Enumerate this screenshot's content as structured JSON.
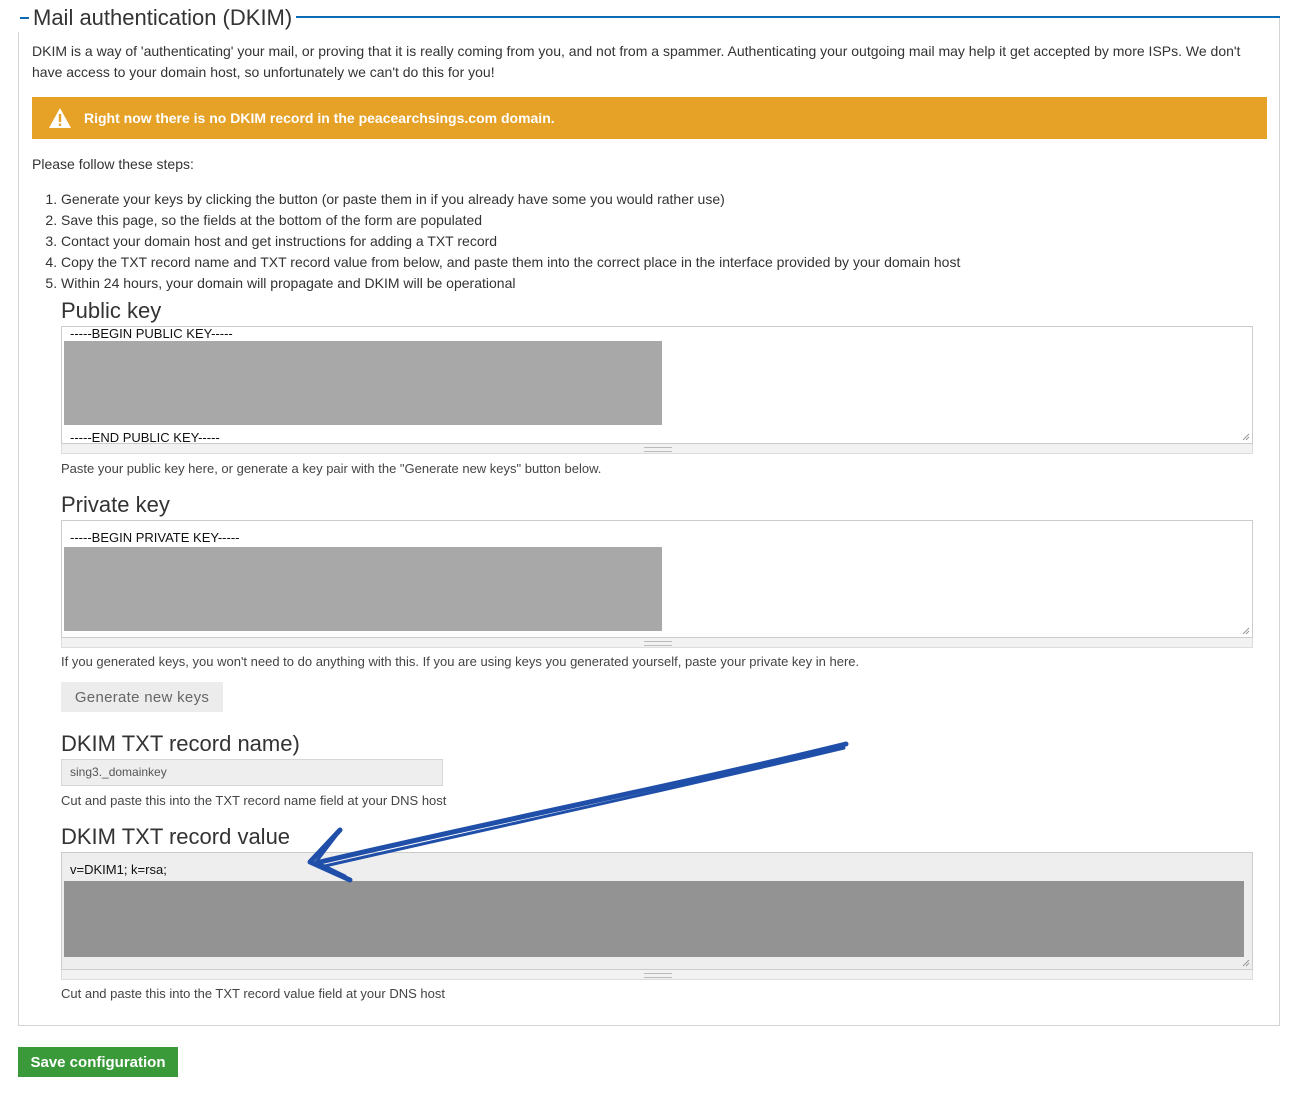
{
  "fieldset": {
    "legend": "Mail authentication (DKIM)",
    "accent_color": "#0c6bb5"
  },
  "intro": "DKIM is a way of 'authenticating' your mail, or proving that it is really coming from you, and not from a spammer. Authenticating your outgoing mail may help it get accepted by more ISPs. We don't have access to your domain host, so unfortunately we can't do this for you!",
  "warning": {
    "icon": "warning-triangle-icon",
    "text": "Right now there is no DKIM record in the peacearchsings.com domain.",
    "color": "#e6a127"
  },
  "steps_intro": "Please follow these steps:",
  "steps": [
    "Generate your keys by clicking the button (or paste them in if you already have some you would rather use)",
    "Save this page, so the fields at the bottom of the form are populated",
    "Contact your domain host and get instructions for adding a TXT record",
    "Copy the TXT record name and TXT record value from below, and paste them into the correct place in the interface provided by your domain host",
    "Within 24 hours, your domain will propagate and DKIM will be operational"
  ],
  "public_key": {
    "label": "Public key",
    "begin": "-----BEGIN PUBLIC KEY-----",
    "end": "-----END PUBLIC KEY-----",
    "description": "Paste your public key here, or generate a key pair with the \"Generate new keys\" button below."
  },
  "private_key": {
    "label": "Private key",
    "begin": "-----BEGIN PRIVATE KEY-----",
    "description": "If you generated keys, you won't need to do anything with this. If you are using keys you generated yourself, paste your private key in here."
  },
  "generate_button": "Generate new keys",
  "txt_name": {
    "label": "DKIM TXT record name)",
    "value": "sing3._domainkey",
    "description": "Cut and paste this into the TXT record name field at your DNS host"
  },
  "txt_value": {
    "label": "DKIM TXT record value",
    "value": "v=DKIM1; k=rsa;",
    "description": "Cut and paste this into the TXT record value field at your DNS host"
  },
  "annotation": {
    "arrow_color": "#1f4fa8"
  },
  "save_button": {
    "label": "Save configuration",
    "color": "#3a9a3a"
  }
}
